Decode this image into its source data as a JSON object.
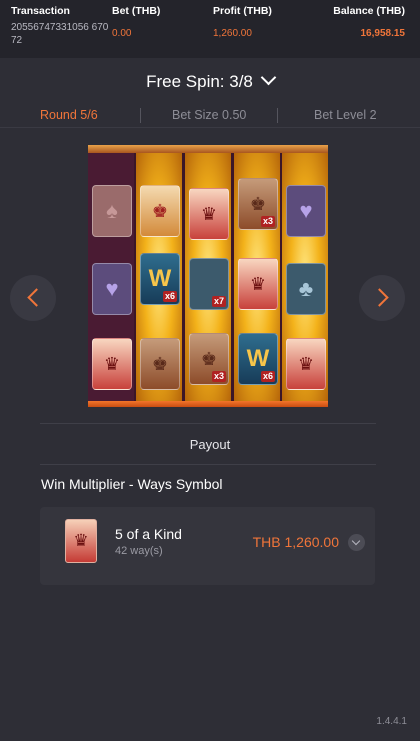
{
  "header": {
    "transaction_label": "Transaction",
    "transaction_value": "20556747331056 67072",
    "bet_label": "Bet (THB)",
    "bet_value": "0.00",
    "profit_label": "Profit (THB)",
    "profit_value": "1,260.00",
    "balance_label": "Balance (THB)",
    "balance_value": "16,958.15"
  },
  "spin": {
    "title": "Free Spin: 3/8"
  },
  "tabs": [
    {
      "label": "Round 5/6",
      "active": true
    },
    {
      "label": "Bet Size 0.50",
      "active": false
    },
    {
      "label": "Bet Level 2",
      "active": false
    }
  ],
  "slot": {
    "multipliers": [
      "x3",
      "x6",
      "x7",
      "x3",
      "x6"
    ]
  },
  "payout": {
    "label": "Payout",
    "section_title": "Win Multiplier - Ways Symbol",
    "item_title": "5 of a Kind",
    "item_sub": "42 way(s)",
    "item_amount": "THB 1,260.00"
  },
  "colors": {
    "accent": "#f0753a",
    "background": "#2e2e36",
    "header_bg": "#24242b"
  },
  "icons": {
    "prev": "chevron-left-icon",
    "next": "chevron-right-icon",
    "dropdown": "chevron-down-icon",
    "expand": "chevron-down-icon"
  },
  "version": "1.4.4.1"
}
